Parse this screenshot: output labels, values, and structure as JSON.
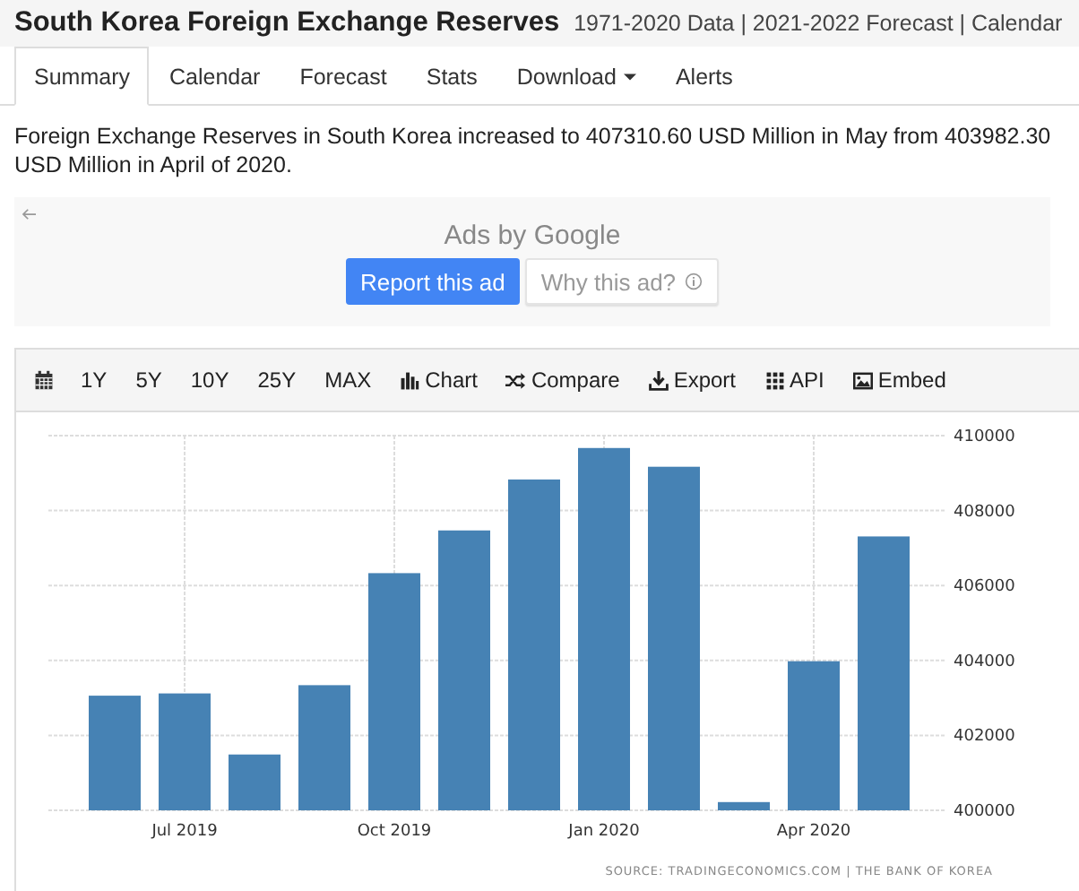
{
  "header": {
    "title": "South Korea Foreign Exchange Reserves",
    "links": "1971-2020 Data | 2021-2022 Forecast | Calendar"
  },
  "tabs": [
    {
      "label": "Summary",
      "selected": true,
      "dropdown": false
    },
    {
      "label": "Calendar",
      "selected": false,
      "dropdown": false
    },
    {
      "label": "Forecast",
      "selected": false,
      "dropdown": false
    },
    {
      "label": "Stats",
      "selected": false,
      "dropdown": false
    },
    {
      "label": "Download",
      "selected": false,
      "dropdown": true
    },
    {
      "label": "Alerts",
      "selected": false,
      "dropdown": false
    }
  ],
  "summary": "Foreign Exchange Reserves in South Korea increased to 407310.60 USD Million in May from 403982.30 USD Million in April of 2020.",
  "ad": {
    "title": "Ads by Google",
    "report_button": "Report this ad",
    "why_button": "Why this ad?"
  },
  "toolbar": [
    {
      "kind": "calendar"
    },
    {
      "kind": "range",
      "label": "1Y"
    },
    {
      "kind": "range",
      "label": "5Y"
    },
    {
      "kind": "range",
      "label": "10Y"
    },
    {
      "kind": "range",
      "label": "25Y"
    },
    {
      "kind": "range",
      "label": "MAX"
    },
    {
      "kind": "chart",
      "label": "Chart"
    },
    {
      "kind": "compare",
      "label": "Compare"
    },
    {
      "kind": "export",
      "label": "Export"
    },
    {
      "kind": "api",
      "label": "API"
    },
    {
      "kind": "embed",
      "label": "Embed"
    }
  ],
  "chart": {
    "source": "SOURCE: TRADINGECONOMICS.COM | THE BANK OF KOREA",
    "chart_data": {
      "type": "bar",
      "categories": [
        null,
        "Jul 2019",
        null,
        null,
        "Oct 2019",
        null,
        null,
        "Jan 2020",
        null,
        null,
        "Apr 2020",
        null
      ],
      "series": [
        {
          "color": "#4682b4",
          "values": [
            403060,
            403120,
            401490,
            403340,
            406330,
            407470,
            408830,
            409670,
            409170,
            400220,
            403980,
            407310
          ]
        }
      ],
      "grid": true,
      "ylim": [
        400000,
        410000
      ],
      "yticks": [
        400000,
        402000,
        404000,
        406000,
        408000,
        410000
      ]
    }
  }
}
